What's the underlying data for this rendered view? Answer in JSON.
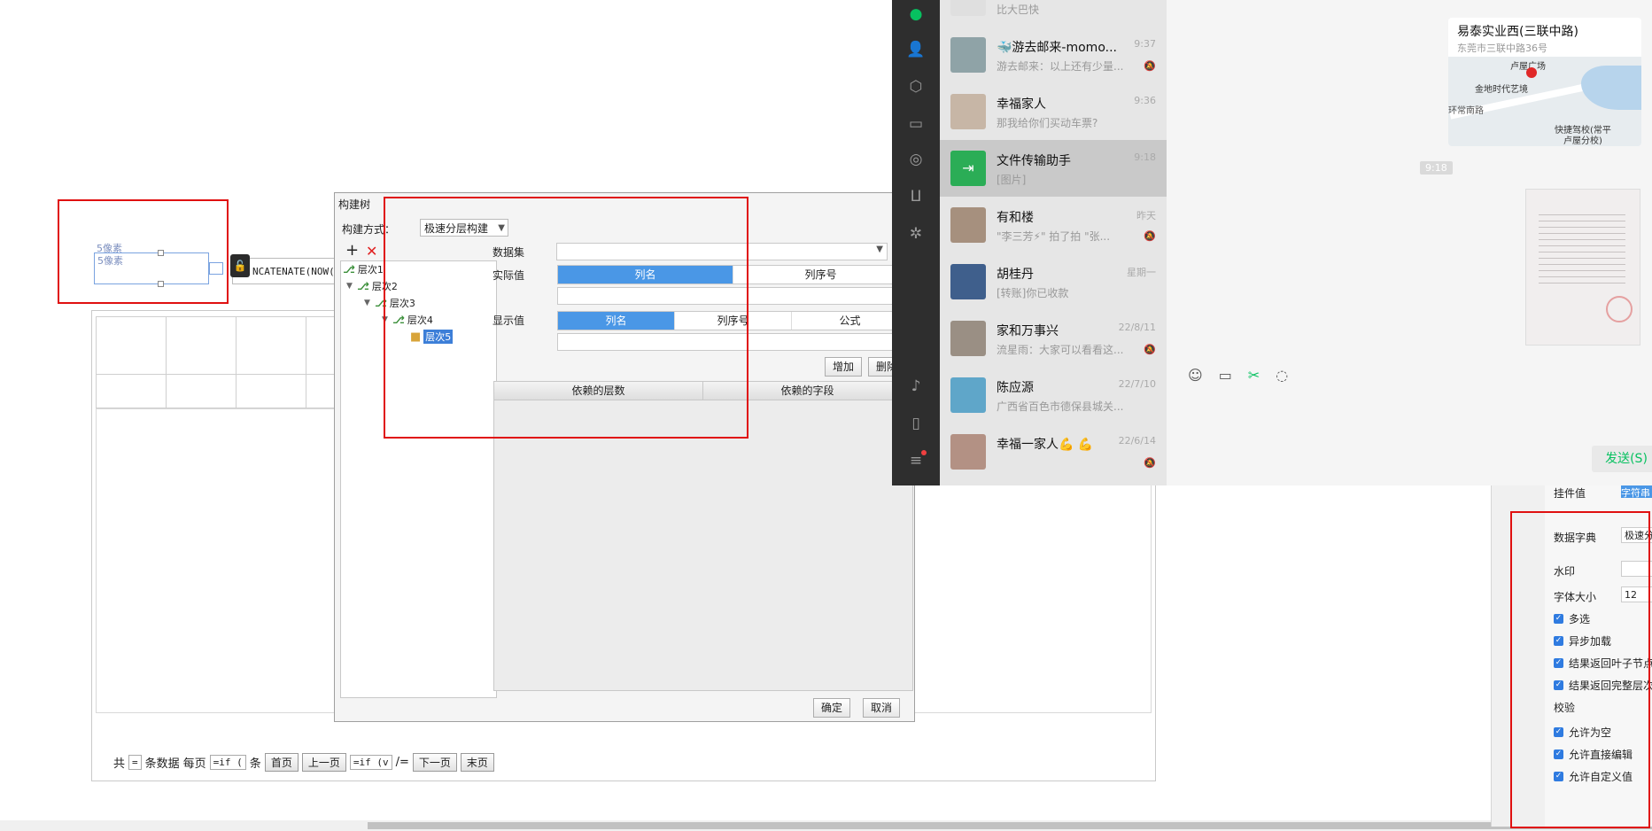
{
  "report": {
    "pixel_tag_1": "5像素",
    "pixel_tag_2": "5像素",
    "formula_text": "NCATENATE(NOW()",
    "pager": {
      "total_prefix": "共",
      "eq": "=",
      "records_label": "条数据",
      "per_page": "每页",
      "formula1": "=if (",
      "unit": "条",
      "first": "首页",
      "prev": "上一页",
      "formula2": "=if (v",
      "slash_eq": "/=",
      "next": "下一页",
      "last": "末页"
    }
  },
  "dialog": {
    "title": "构建树",
    "method_label": "构建方式：",
    "method_value": "极速分层构建",
    "tree_nodes": [
      "层次1",
      "层次2",
      "层次3",
      "层次4",
      "层次5"
    ],
    "dataset_label": "数据集",
    "actual_label": "实际值",
    "display_label": "显示值",
    "actual_tabs": [
      "列名",
      "列序号"
    ],
    "display_tabs": [
      "列名",
      "列序号",
      "公式"
    ],
    "add_btn": "增加",
    "delete_btn": "删除",
    "dep_cols": [
      "依赖的层数",
      "依赖的字段"
    ],
    "ok": "确定",
    "cancel": "取消"
  },
  "wechat": {
    "chats": [
      {
        "name": "",
        "preview": "比大巴快",
        "time": ""
      },
      {
        "name": "🐳游去邮来-momo...",
        "preview": "游去邮来：以上还有少量...",
        "time": "9:37",
        "muted": true
      },
      {
        "name": "幸福家人",
        "preview": "那我给你们买动车票?",
        "time": "9:36"
      },
      {
        "name": "文件传输助手",
        "preview": "[图片]",
        "time": "9:18",
        "active": true
      },
      {
        "name": "有和楼",
        "preview": "\"李三芳⚡\" 拍了拍 \"张...",
        "time": "昨天",
        "muted": true
      },
      {
        "name": "胡桂丹",
        "preview": "[转账]你已收款",
        "time": "星期一"
      },
      {
        "name": "家和万事兴",
        "preview": "流星雨：大家可以看看这...",
        "time": "22/8/11",
        "muted": true
      },
      {
        "name": "陈应源",
        "preview": "广西省百色市德保县城关...",
        "time": "22/7/10"
      },
      {
        "name": "幸福一家人💪 💪",
        "preview": "",
        "time": "22/6/14",
        "muted": true
      }
    ],
    "location": {
      "title": "易泰实业西(三联中路)",
      "address": "东莞市三联中路36号",
      "map_labels": [
        "卢屋广场",
        "金地时代艺境",
        "环常南路",
        "快捷驾校(常平",
        "卢屋分校)"
      ]
    },
    "time_chip": "9:18",
    "send": "发送(S)"
  },
  "props": {
    "partial_top": "挂件值",
    "partial_btn": "字符串",
    "dict_label": "数据字典",
    "dict_value": "极速分",
    "watermark_label": "水印",
    "fontsize_label": "字体大小",
    "fontsize_value": "12",
    "checks1": [
      "多选",
      "异步加载",
      "结果返回叶子节点",
      "结果返回完整层次"
    ],
    "validate_label": "校验",
    "checks2": [
      "允许为空",
      "允许直接编辑",
      "允许自定义值"
    ]
  }
}
